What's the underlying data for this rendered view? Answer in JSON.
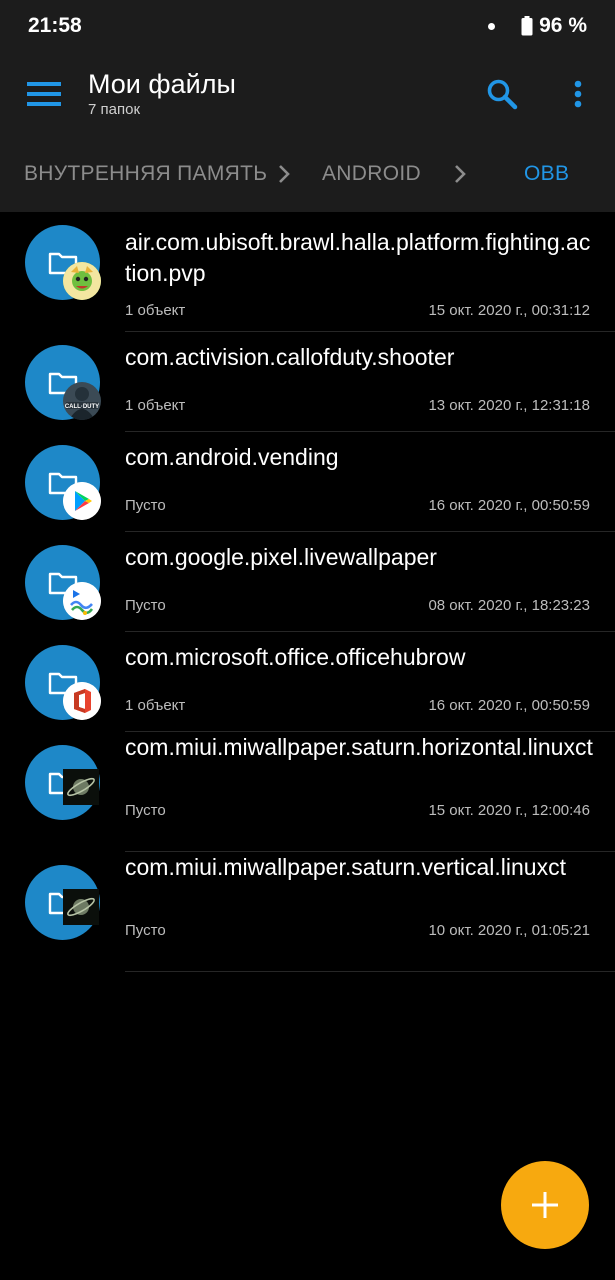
{
  "status": {
    "time": "21:58",
    "battery": "96 %"
  },
  "app_bar": {
    "title": "Мои файлы",
    "subtitle": "7 папок"
  },
  "breadcrumb": [
    "ВНУТРЕННЯЯ ПАМЯТЬ",
    "ANDROID",
    "OBB"
  ],
  "colors": {
    "accent": "#2196e6",
    "folder": "#1e88c8",
    "fab": "#f7a90f",
    "bar": "#1c1c1c"
  },
  "files": [
    {
      "name": "air.com.ubisoft.brawl.halla.platform.fighting.action.pvp",
      "meta": "1 объект",
      "date": "15 окт. 2020 г., 00:31:12",
      "badge": "brawlhalla-icon"
    },
    {
      "name": "com.activision.callofduty.shooter",
      "meta": "1 объект",
      "date": "13 окт. 2020 г., 12:31:18",
      "badge": "callofduty-icon"
    },
    {
      "name": "com.android.vending",
      "meta": "Пусто",
      "date": "16 окт. 2020 г., 00:50:59",
      "badge": "play-store-icon"
    },
    {
      "name": "com.google.pixel.livewallpaper",
      "meta": "Пусто",
      "date": "08 окт. 2020 г., 18:23:23",
      "badge": "live-wallpaper-icon"
    },
    {
      "name": "com.microsoft.office.officehubrow",
      "meta": "1 объект",
      "date": "16 окт. 2020 г., 00:50:59",
      "badge": "office-icon"
    },
    {
      "name": "com.miui.miwallpaper.saturn.horizontal.linuxct",
      "meta": "Пусто",
      "date": "15 окт. 2020 г., 12:00:46",
      "badge": "saturn-icon"
    },
    {
      "name": "com.miui.miwallpaper.saturn.vertical.linuxct",
      "meta": "Пусто",
      "date": "10 окт. 2020 г., 01:05:21",
      "badge": "saturn-icon"
    }
  ],
  "fab": {
    "icon": "plus-icon"
  }
}
